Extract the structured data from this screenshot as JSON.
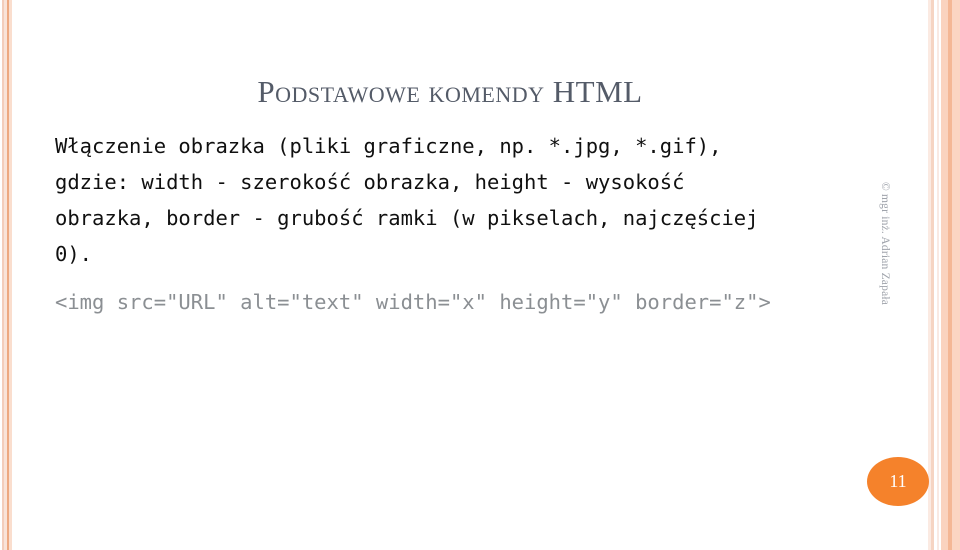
{
  "slide": {
    "title": "Podstawowe komendy HTML",
    "body_lines": [
      "Włączenie obrazka (pliki graficzne, np. *.jpg, *.gif),",
      "gdzie: width - szerokość obrazka, height - wysokość",
      "obrazka, border - grubość ramki (w pikselach, najczęściej",
      "0)."
    ],
    "code_line": "<img src=\"URL\" alt=\"text\" width=\"x\" height=\"y\" border=\"z\">",
    "copyright": "© mgr inż. Adrian Zapała",
    "page_number": "11"
  },
  "colors": {
    "title": "#545b68",
    "body_text": "#101010",
    "code_text": "#8b8f93",
    "badge": "#f5822b",
    "badge_text": "#ffffff",
    "stripe_light": "#fadece",
    "stripe_dark": "#eda880",
    "background": "#ffffff"
  }
}
